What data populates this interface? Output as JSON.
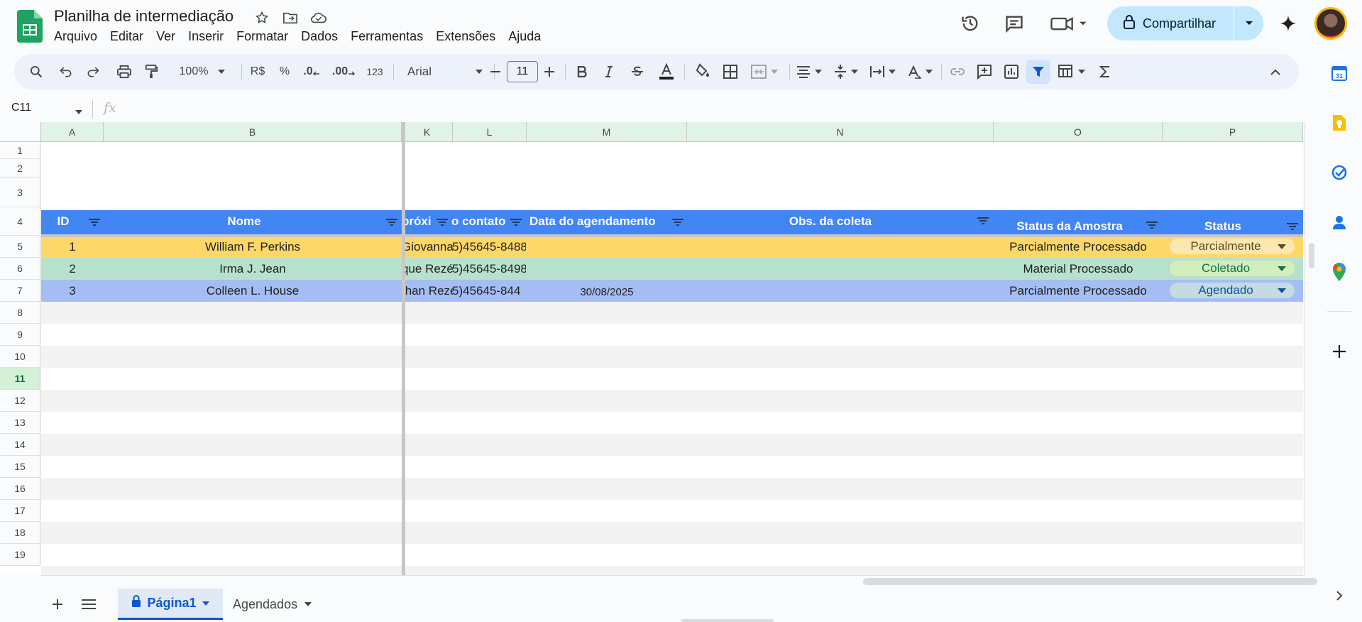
{
  "app": {
    "title": "Planilha de intermediação",
    "menu": [
      "Arquivo",
      "Editar",
      "Ver",
      "Inserir",
      "Formatar",
      "Dados",
      "Ferramentas",
      "Extensões",
      "Ajuda"
    ],
    "share_label": "Compartilhar"
  },
  "toolbar": {
    "zoom": "100%",
    "currency": "R$",
    "percent": "%",
    "dec_less": ".0",
    "dec_more": ".00",
    "format_123": "123",
    "font": "Arial",
    "font_size": "11"
  },
  "formula": {
    "cell_ref": "C11",
    "fx_label": "fx"
  },
  "columns": [
    "A",
    "B",
    "K",
    "L",
    "M",
    "N",
    "O",
    "P"
  ],
  "rows": [
    "1",
    "2",
    "3",
    "4",
    "5",
    "6",
    "7",
    "8",
    "9",
    "10",
    "11",
    "12",
    "13",
    "14",
    "15",
    "16",
    "17",
    "18",
    "19"
  ],
  "header": {
    "id": "ID",
    "nome": "Nome",
    "proximo": "próxi",
    "contato": "o contato",
    "data_agendamento": "Data do agendamento",
    "obs_coleta": "Obs. da coleta",
    "status_amostra": "Status da Amostra",
    "status": "Status"
  },
  "data_rows": [
    {
      "id": "1",
      "nome": "William F. Perkins",
      "proximo": "Giovanna",
      "contato": "5)45645-8488",
      "data": "",
      "status_amostra": "Parcialmente Processado",
      "status": "Parcialmente",
      "row_color": "#fdd868",
      "chip_color": "#fbe7b0",
      "chip_text": "#5b4a1a"
    },
    {
      "id": "2",
      "nome": "Irma J. Jean",
      "proximo": "que Rezé",
      "contato": "5)45645-8498",
      "data": "",
      "status_amostra": "Material Processado",
      "status": "Coletado",
      "row_color": "#b7e1cd",
      "chip_color": "#d4edbc",
      "chip_text": "#11734b"
    },
    {
      "id": "3",
      "nome": "Colleen L. House",
      "proximo": "than Rezé",
      "contato": "5)45645-844",
      "data": "30/08/2025",
      "status_amostra": "Parcialmente Processado",
      "status": "Agendado",
      "row_color": "#a4bdf5",
      "chip_color": "#c6dbe1",
      "chip_text": "#0a53a8"
    }
  ],
  "sheets": {
    "tab1": "Página1",
    "tab2": "Agendados"
  },
  "colors": {
    "header_blue": "#4285f4",
    "accent": "#0b57d0",
    "share_bg": "#c2e7ff"
  }
}
